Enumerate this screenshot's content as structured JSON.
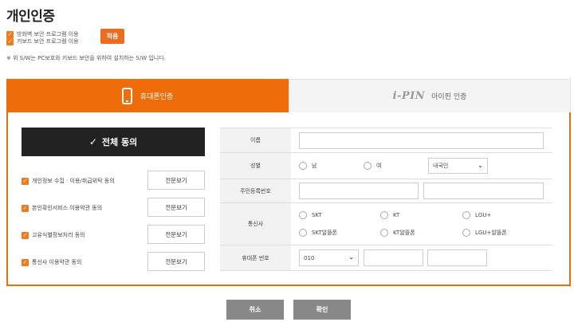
{
  "page": {
    "title": "개인인증"
  },
  "security": {
    "items": [
      "방화벽 보안 프로그램 이용",
      "키보드 보안 프로그램 이용"
    ],
    "apply_label": "적용",
    "note": "※ 위 S/W는 PC보호와 키보드 보안을 위하여 설치하는 S/W 입니다."
  },
  "tabs": {
    "phone_label": "휴대폰인증",
    "ipin_logo": "i-PIN",
    "ipin_label": "아이핀 인증"
  },
  "terms": {
    "all_agree_label": "전체 동의",
    "check_mark": "✓",
    "items": [
      {
        "label": "개인정보 수집 · 이용/취급위탁 동의",
        "view_label": "전문보기"
      },
      {
        "label": "본인확인서비스 이용약관 동의",
        "view_label": "전문보기"
      },
      {
        "label": "고유식별정보처리 동의",
        "view_label": "전문보기"
      },
      {
        "label": "통신사 이용약관 동의",
        "view_label": "전문보기"
      }
    ]
  },
  "form": {
    "name_label": "이름",
    "gender_label": "성별",
    "gender_options": [
      "남",
      "여"
    ],
    "nationality_selected": "내국인",
    "rrn_label": "주민등록번호",
    "carrier_label": "통신사",
    "carriers": [
      "SKT",
      "KT",
      "LGU+",
      "SKT알뜰폰",
      "KT알뜰폰",
      "LGU+알뜰폰"
    ],
    "phone_label": "휴대폰 번호",
    "phone_prefix": "010"
  },
  "buttons": {
    "cancel": "취소",
    "confirm": "확인"
  },
  "colors": {
    "accent": "#ef6c0b",
    "dark": "#222222",
    "gray_button": "#888888"
  }
}
